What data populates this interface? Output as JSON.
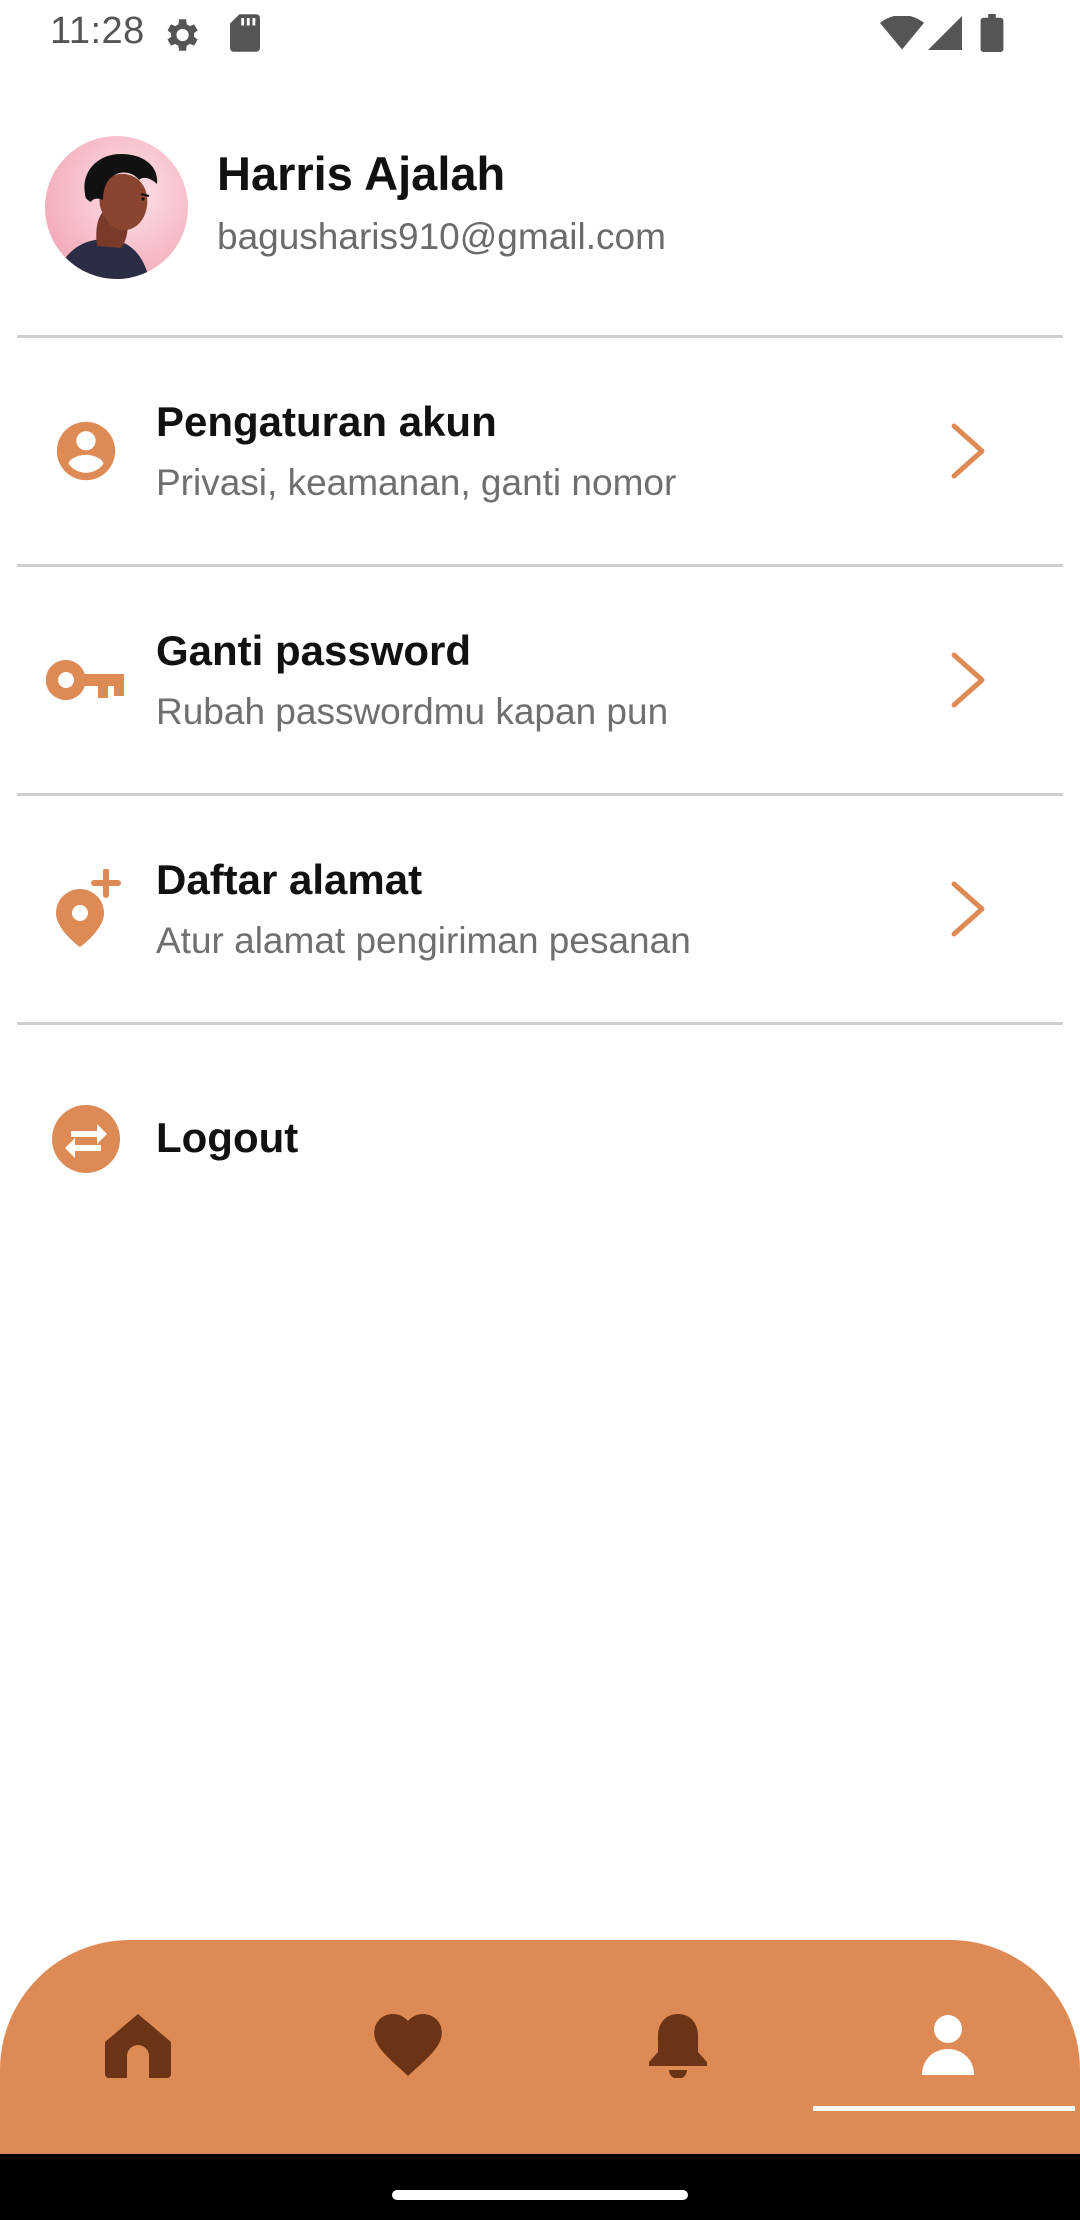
{
  "status_bar": {
    "time": "11:28",
    "left_icons": [
      "settings-icon",
      "sd-card-icon"
    ],
    "right_icons": [
      "wifi-icon",
      "signal-icon",
      "battery-icon"
    ]
  },
  "profile": {
    "name": "Harris Ajalah",
    "email": "bagusharis910@gmail.com"
  },
  "menu": [
    {
      "icon": "account-circle-icon",
      "title": "Pengaturan akun",
      "subtitle": "Privasi, keamanan, ganti nomor"
    },
    {
      "icon": "key-icon",
      "title": "Ganti password",
      "subtitle": "Rubah passwordmu kapan pun"
    },
    {
      "icon": "add-location-icon",
      "title": "Daftar alamat",
      "subtitle": "Atur alamat pengiriman pesanan"
    }
  ],
  "logout": {
    "icon": "swap-icon",
    "label": "Logout"
  },
  "bottom_nav": {
    "items": [
      {
        "icon": "home-icon",
        "active": false
      },
      {
        "icon": "heart-icon",
        "active": false
      },
      {
        "icon": "bell-icon",
        "active": false
      },
      {
        "icon": "person-icon",
        "active": true
      }
    ]
  },
  "colors": {
    "accent": "#dd8a55",
    "nav_icon_inactive": "#6b3416",
    "nav_icon_active": "#ffffff",
    "divider": "#cfcfcf"
  }
}
